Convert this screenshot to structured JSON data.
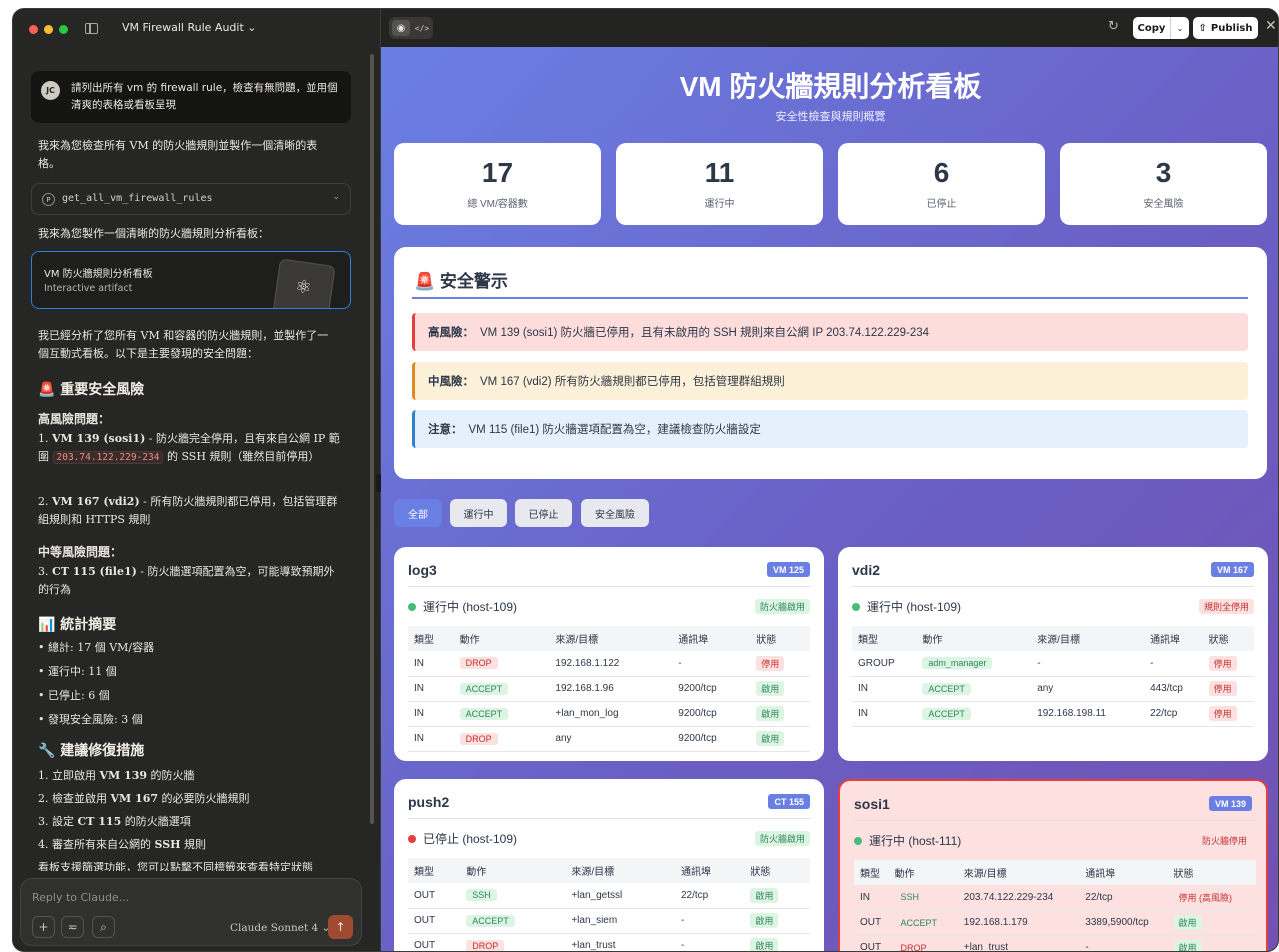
{
  "window": {
    "title": "VM Firewall Rule Audit ⌄"
  },
  "chat": {
    "user_avatar": "JC",
    "user_message": "請列出所有 vm 的 firewall rule，檢查有無問題，並用個清爽的表格或看板呈現",
    "p1": "我來為您檢查所有 VM 的防火牆規則並製作一個清晰的表格。",
    "tool_icon": "P",
    "tool_name": "get_all_vm_firewall_rules",
    "p2": "我來為您製作一個清晰的防火牆規則分析看板：",
    "artifact_title": "VM 防火牆規則分析看板",
    "artifact_sub": "Interactive artifact",
    "p3": "我已經分析了您所有 VM 和容器的防火牆規則，並製作了一個互動式看板。以下是主要發現的安全問題：",
    "h_risk": "🚨 重要安全風險",
    "sub_high": "高風險問題：",
    "i1_b": "VM 139 (sosi1)",
    "i1_a": " - 防火牆完全停用，且有來自公網 IP 範圍 ",
    "i1_code": "203.74.122.229-234",
    "i1_c": " 的 SSH 規則（雖然目前停用）",
    "i2_b": "VM 167 (vdi2)",
    "i2_a": " - 所有防火牆規則都已停用，包括管理群組規則和 HTTPS 規則",
    "sub_mid": "中等風險問題：",
    "i3_b": "CT 115 (file1)",
    "i3_a": " - 防火牆選項配置為空，可能導致預期外的行為",
    "h_stats": "📊 統計摘要",
    "s1": "總計: 17 個 VM/容器",
    "s2": "運行中: 11 個",
    "s3": "已停止: 6 個",
    "s4": "發現安全風險: 3 個",
    "h_fix": "🔧 建議修復措施",
    "f1_a": "立即啟用 ",
    "f1_b": "VM 139",
    "f1_c": " 的防火牆",
    "f2_a": "檢查並啟用 ",
    "f2_b": "VM 167",
    "f2_c": " 的必要防火牆規則",
    "f3_a": "設定 ",
    "f3_b": "CT 115",
    "f3_c": " 的防火牆選項",
    "f4_a": "審查所有來自公網的 ",
    "f4_b": "SSH",
    "f4_c": " 規則",
    "p_last": "看板支援篩選功能，您可以點擊不同標籤來查看特定狀態"
  },
  "composer": {
    "placeholder": "Reply to Claude...",
    "model": "Claude Sonnet 4 ⌄"
  },
  "toolbar": {
    "copy": "Copy",
    "publish": "Publish"
  },
  "dashboard": {
    "title": "VM 防火牆規則分析看板",
    "subtitle": "安全性檢查與規則概覽",
    "stats": [
      {
        "value": "17",
        "label": "總 VM/容器數"
      },
      {
        "value": "11",
        "label": "運行中"
      },
      {
        "value": "6",
        "label": "已停止"
      },
      {
        "value": "3",
        "label": "安全風險"
      }
    ],
    "alerts_title": "🚨 安全警示",
    "alerts": [
      {
        "level": "高風險：",
        "text": "VM 139 (sosi1) 防火牆已停用，且有未啟用的 SSH 規則來自公網 IP 203.74.122.229-234",
        "bg": "#fddcdc",
        "border": "#e53e3e"
      },
      {
        "level": "中風險：",
        "text": "VM 167 (vdi2) 所有防火牆規則都已停用，包括管理群組規則",
        "bg": "#fdf0d8",
        "border": "#dd8a24"
      },
      {
        "level": "注意：",
        "text": "VM 115 (file1) 防火牆選項配置為空，建議檢查防火牆設定",
        "bg": "#e4f0fc",
        "border": "#3182ce"
      }
    ],
    "filters": [
      "全部",
      "運行中",
      "已停止",
      "安全風險"
    ],
    "table_headers": [
      "類型",
      "動作",
      "來源/目標",
      "通訊埠",
      "狀態"
    ],
    "cards": [
      {
        "name": "log3",
        "id": "VM 125",
        "status": "運行中 (host-109)",
        "running": true,
        "fw": "防火牆啟用",
        "fw_ok": true,
        "rows": [
          [
            "IN",
            "DROP",
            "192.168.1.122",
            "-",
            "停用"
          ],
          [
            "IN",
            "ACCEPT",
            "192.168.1.96",
            "9200/tcp",
            "啟用"
          ],
          [
            "IN",
            "ACCEPT",
            "+lan_mon_log",
            "9200/tcp",
            "啟用"
          ],
          [
            "IN",
            "DROP",
            "any",
            "9200/tcp",
            "啟用"
          ]
        ]
      },
      {
        "name": "vdi2",
        "id": "VM 167",
        "status": "運行中 (host-109)",
        "running": true,
        "fw": "規則全停用",
        "fw_ok": false,
        "rows": [
          [
            "GROUP",
            "adm_manager",
            "-",
            "-",
            "停用"
          ],
          [
            "IN",
            "ACCEPT",
            "any",
            "443/tcp",
            "停用"
          ],
          [
            "IN",
            "ACCEPT",
            "192.168.198.11",
            "22/tcp",
            "停用"
          ]
        ]
      },
      {
        "name": "push2",
        "id": "CT 155",
        "status": "已停止 (host-109)",
        "running": false,
        "fw": "防火牆啟用",
        "fw_ok": true,
        "rows": [
          [
            "OUT",
            "SSH",
            "+lan_getssl",
            "22/tcp",
            "啟用"
          ],
          [
            "OUT",
            "ACCEPT",
            "+lan_siem",
            "-",
            "啟用"
          ],
          [
            "OUT",
            "DROP",
            "+lan_trust",
            "-",
            "啟用"
          ]
        ]
      },
      {
        "name": "sosi1",
        "id": "VM 139",
        "status": "運行中 (host-111)",
        "running": true,
        "fw": "防火牆停用",
        "fw_ok": false,
        "rows": [
          [
            "IN",
            "SSH",
            "203.74.122.229-234",
            "22/tcp",
            "停用 (高風險)"
          ],
          [
            "OUT",
            "ACCEPT",
            "192.168.1.179",
            "3389,5900/tcp",
            "啟用"
          ],
          [
            "OUT",
            "DROP",
            "+lan_trust",
            "-",
            "啟用"
          ]
        ]
      }
    ]
  },
  "colors": {
    "accent": "#6a7fe3",
    "green": "#48bb78",
    "red": "#e53e3e"
  }
}
